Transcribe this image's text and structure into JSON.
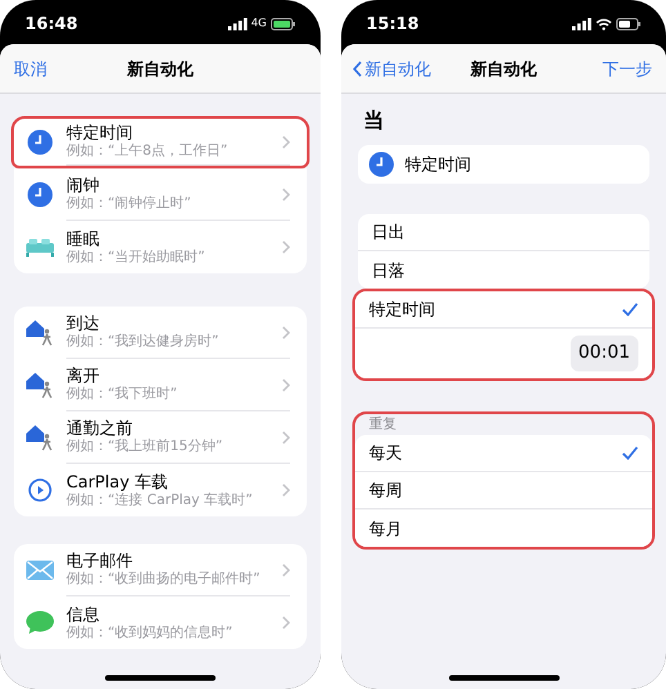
{
  "left_phone": {
    "status_bar": {
      "time": "16:48",
      "network": "4G"
    },
    "nav": {
      "left": "取消",
      "title": "新自动化"
    },
    "groups": [
      [
        {
          "kind": "clock",
          "title": "特定时间",
          "subtitle": "例如：“上午8点，工作日”",
          "highlighted": true
        },
        {
          "kind": "clock",
          "title": "闹钟",
          "subtitle": "例如：“闹钟停止时”",
          "highlighted": false
        },
        {
          "kind": "bed",
          "title": "睡眠",
          "subtitle": "例如：“当开始助眠时”",
          "highlighted": false
        }
      ],
      [
        {
          "kind": "home",
          "title": "到达",
          "subtitle": "例如：“我到达健身房时”",
          "highlighted": false
        },
        {
          "kind": "home",
          "title": "离开",
          "subtitle": "例如：“我下班时”",
          "highlighted": false
        },
        {
          "kind": "home",
          "title": "通勤之前",
          "subtitle": "例如：“我上班前15分钟”",
          "highlighted": false
        },
        {
          "kind": "carplay",
          "title": "CarPlay 车载",
          "subtitle": "例如：“连接 CarPlay 车载时”",
          "highlighted": false
        }
      ],
      [
        {
          "kind": "mail",
          "title": "电子邮件",
          "subtitle": "例如：“收到曲扬的电子邮件时”",
          "highlighted": false
        },
        {
          "kind": "message",
          "title": "信息",
          "subtitle": "例如：“收到妈妈的信息时”",
          "highlighted": false
        }
      ]
    ]
  },
  "right_phone": {
    "status_bar": {
      "time": "15:18"
    },
    "nav": {
      "back": "新自动化",
      "title": "新自动化",
      "right": "下一步"
    },
    "heading": "当",
    "trigger": {
      "label": "特定时间"
    },
    "sections": [
      {
        "highlighted": false,
        "rows": [
          {
            "kind": "option",
            "label": "日出",
            "selected": false
          },
          {
            "kind": "option",
            "label": "日落",
            "selected": false
          }
        ]
      },
      {
        "highlighted": true,
        "rows": [
          {
            "kind": "option",
            "label": "特定时间",
            "selected": true
          },
          {
            "kind": "time",
            "value": "00:01"
          }
        ]
      },
      {
        "highlighted": true,
        "header": "重复",
        "rows": [
          {
            "kind": "option",
            "label": "每天",
            "selected": true
          },
          {
            "kind": "option",
            "label": "每周",
            "selected": false
          },
          {
            "kind": "option",
            "label": "每月",
            "selected": false
          }
        ]
      }
    ]
  }
}
